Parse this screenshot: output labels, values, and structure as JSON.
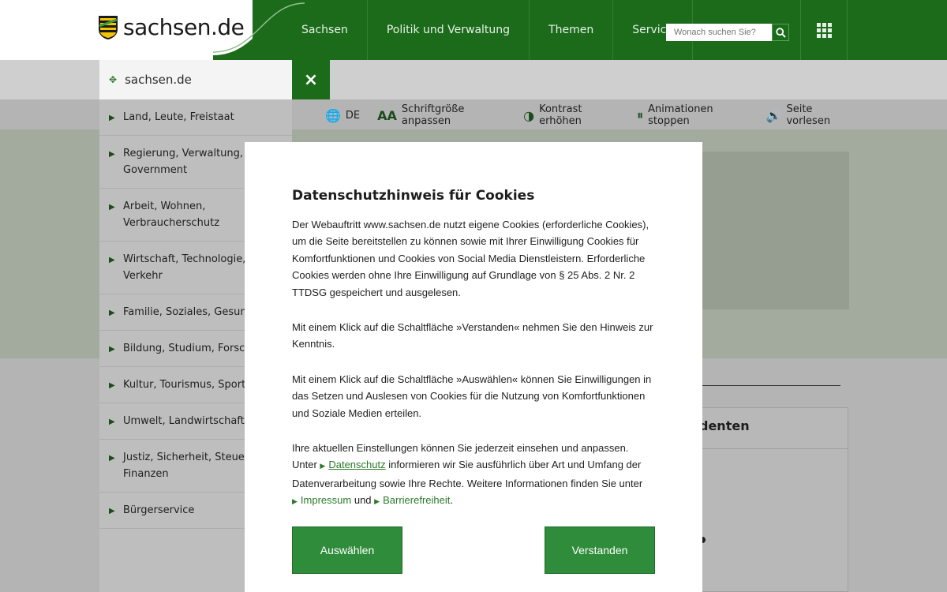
{
  "header": {
    "logo_text": "sachsen.de",
    "nav": [
      "Sachsen",
      "Politik und Verwaltung",
      "Themen",
      "Service"
    ],
    "search_placeholder": "Wonach suchen Sie?"
  },
  "subbar": {
    "label": "sachsen.de",
    "close": "×"
  },
  "toolbar": {
    "language": "DE",
    "font_size": "Schriftgröße anpassen",
    "contrast": "Kontrast erhöhen",
    "animations": "Animationen stoppen",
    "read_aloud": "Seite vorlesen"
  },
  "sidebar": {
    "items": [
      "Land, Leute, Freistaat",
      "Regierung, Verwaltung, E-Government",
      "Arbeit, Wohnen, Verbraucherschutz",
      "Wirtschaft, Technologie, Verkehr",
      "Familie, Soziales, Gesundheit",
      "Bildung, Studium, Forschung",
      "Kultur, Tourismus, Sport",
      "Umwelt, Landwirtschaft, Wald",
      "Justiz, Sicherheit, Steuern, Finanzen",
      "Bürgerservice"
    ]
  },
  "background": {
    "side_card_title": "denten"
  },
  "modal": {
    "title": "Datenschutzhinweis für Cookies",
    "p1": "Der Webauftritt www.sachsen.de nutzt eigene Cookies (erforderliche Cookies), um die Seite bereitstellen zu können sowie mit Ihrer Einwilligung Cookies für Komfortfunktionen und Cookies von Social Media Dienstleistern. Erforderliche Cookies werden ohne Ihre Einwilligung auf Grundlage von § 25 Abs. 2 Nr. 2 TTDSG gespeichert und ausgelesen.",
    "p2": "Mit einem Klick auf die Schaltfläche »Verstanden« nehmen Sie den Hinweis zur Kenntnis.",
    "p3": "Mit einem Klick auf die Schaltfläche »Auswählen« können Sie Einwilligungen in das Setzen und Auslesen von Cookies für die Nutzung von Komfortfunktionen und Soziale Medien erteilen.",
    "p4_a": "Ihre aktuellen Einstellungen können Sie jederzeit einsehen und anpassen. Unter",
    "link_datenschutz": "Datenschutz",
    "p4_b": "informieren wir Sie ausführlich über Art und Umfang der Datenverarbeitung sowie Ihre Rechte. Weitere Informationen finden Sie unter",
    "link_impressum": "Impressum",
    "p4_and": "und",
    "link_barrierefreiheit": "Barrierefreiheit",
    "p4_end": ".",
    "btn_select": "Auswählen",
    "btn_ok": "Verstanden"
  },
  "colors": {
    "brand_green": "#1b6b1b",
    "button_green": "#2f8c3a",
    "link_green": "#2a7a2a"
  }
}
